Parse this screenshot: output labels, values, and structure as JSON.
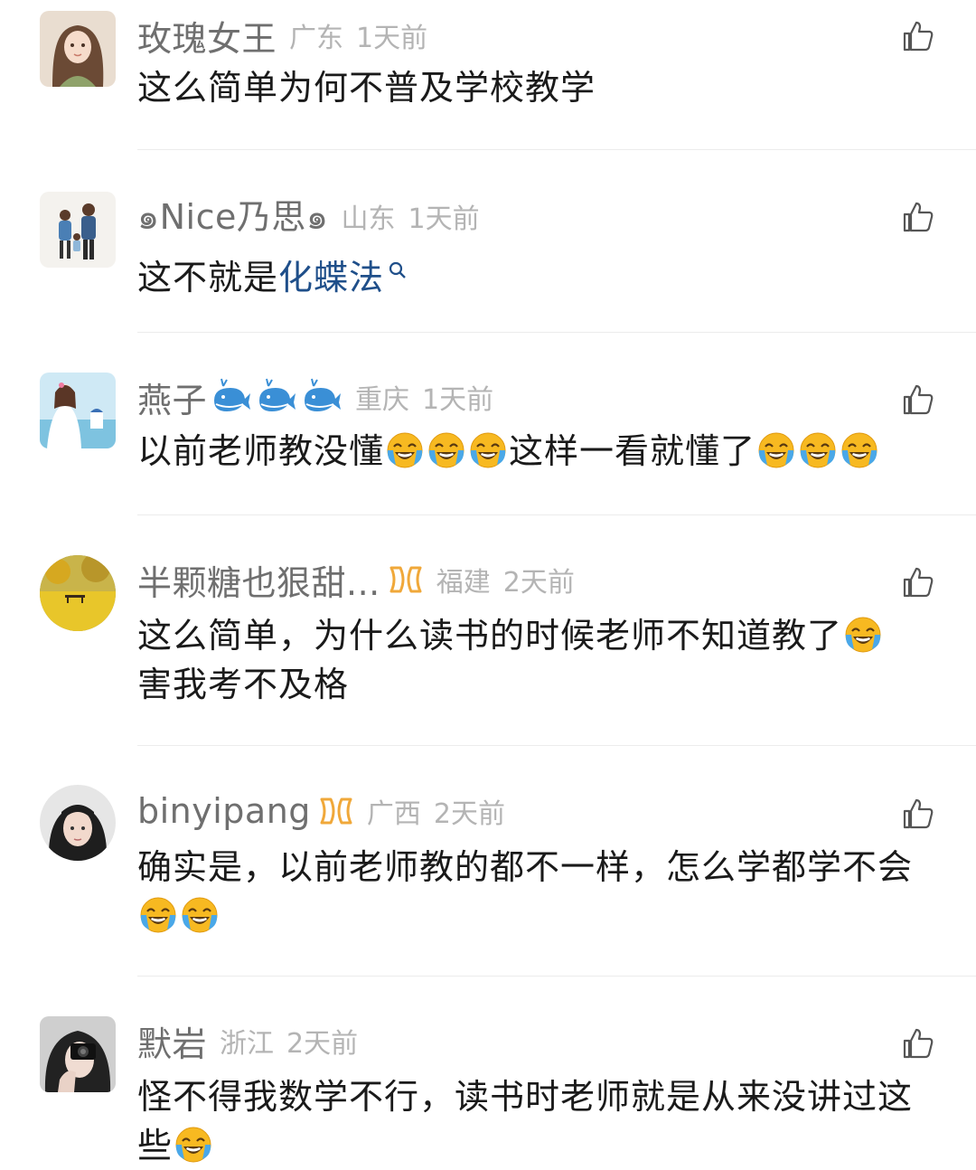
{
  "comments": [
    {
      "username": "玫瑰女王",
      "location": "广东",
      "time": "1天前",
      "text_parts": [
        "这么简单为何不普及学校教学"
      ]
    },
    {
      "username": "๑Nice乃思๑",
      "location": "山东",
      "time": "1天前",
      "text_plain": "这不就是",
      "text_link": "化蝶法"
    },
    {
      "username": "燕子",
      "location": "重庆",
      "time": "1天前",
      "text_a": "以前老师教没懂",
      "text_b": "这样一看就懂了"
    },
    {
      "username": "半颗糖也狠甜...",
      "location": "福建",
      "time": "2天前",
      "text_a": "这么简单，为什么读书的时候老师不知道教了",
      "text_b": "害我考不及格"
    },
    {
      "username": "binyipang",
      "location": "广西",
      "time": "2天前",
      "text_a": "确实是，以前老师教的都不一样，怎么学都学不会"
    },
    {
      "username": "默岩",
      "location": "浙江",
      "time": "2天前",
      "text_a": "怪不得我数学不行，读书时老师就是从来没讲过这",
      "text_b": "些"
    }
  ],
  "icons": {
    "like": "thumbs-up-icon",
    "emoji": "crying-laughing-emoji",
    "vip_badge": "infinity-badge-icon",
    "whale": "whale-emoji",
    "search": "search-icon"
  },
  "colors": {
    "username": "#6f6f6f",
    "meta": "#b4b4b4",
    "link": "#1f4f8a",
    "badge": "#f0a83a",
    "emoji": "#f7b921"
  }
}
